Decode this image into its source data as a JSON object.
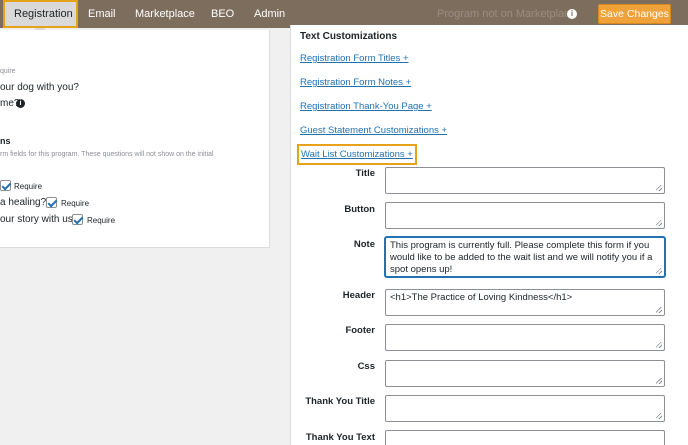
{
  "topbar": {
    "tabs": [
      {
        "label": "Registration",
        "active": true
      },
      {
        "label": "Email"
      },
      {
        "label": "Marketplace"
      },
      {
        "label": "BEO"
      },
      {
        "label": "Admin"
      }
    ],
    "status_text": "Program not on Marketplace",
    "info_icon": "i",
    "save_label": "Save Changes"
  },
  "left": {
    "require_top": "quire",
    "q_dog": "our dog with you?",
    "q_name": "me?",
    "section_title": "ns",
    "section_desc": "rm fields for this program. These questions will not show on the initial",
    "require_1": "Require",
    "q_healing": "a healing?",
    "require_2": "Require",
    "q_story": "our story with us",
    "require_3": "Require"
  },
  "right": {
    "heading": "Text Customizations",
    "links": [
      "Registration Form Titles +",
      "Registration Form Notes +",
      "Registration Thank-You Page +",
      "Guest Statement Customizations +",
      "Wait List Customizations +"
    ],
    "fields": [
      {
        "label": "Title",
        "value": ""
      },
      {
        "label": "Button",
        "value": ""
      },
      {
        "label": "Note",
        "value": "This program is currently full. Please complete this form if you would like to be added to the wait list and we will notify you if a spot opens up!"
      },
      {
        "label": "Header",
        "value": "<h1>The Practice of Loving Kindness</h1>"
      },
      {
        "label": "Footer",
        "value": ""
      },
      {
        "label": "Css",
        "value": ""
      },
      {
        "label": "Thank You Title",
        "value": ""
      },
      {
        "label": "Thank You Text",
        "value": ""
      }
    ]
  },
  "colors": {
    "topbar": "#7d6d5d",
    "accent": "#f0a23a",
    "highlight": "#e6a21a",
    "link": "#2271b1"
  }
}
